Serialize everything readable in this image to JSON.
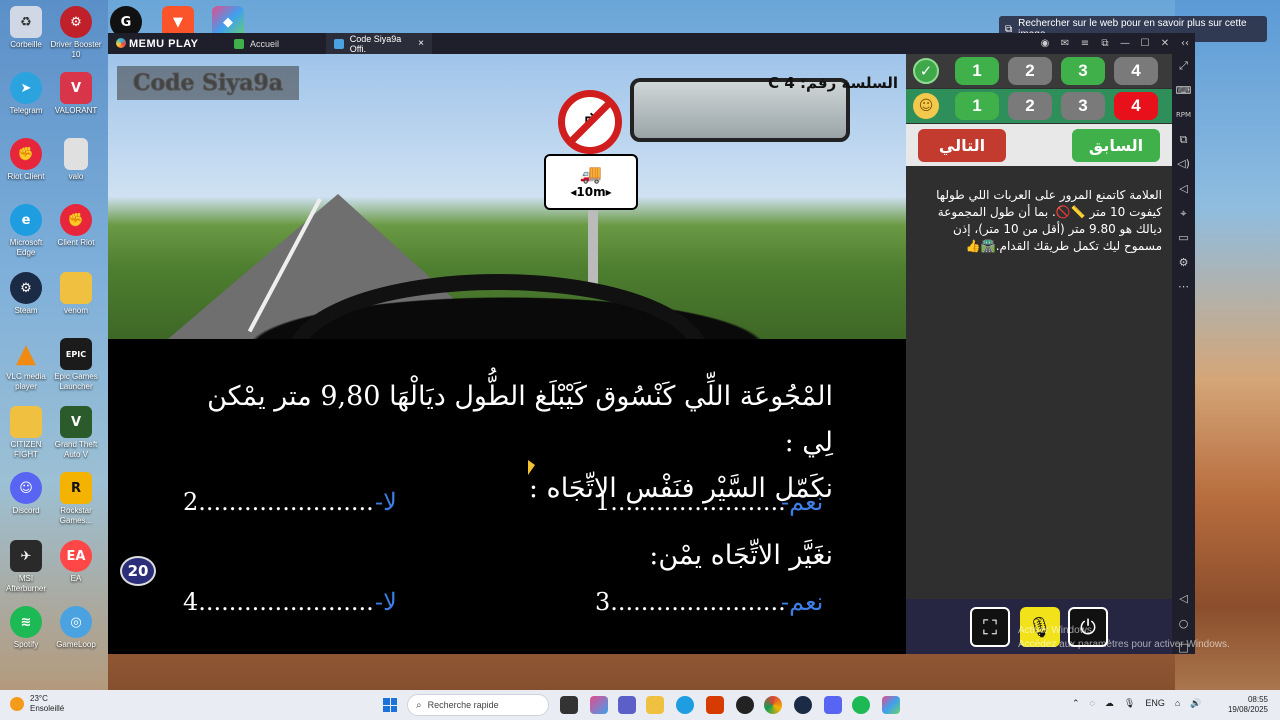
{
  "desktop": {
    "icons": [
      {
        "label": "Corbeille",
        "icon": "recycle-bin-icon",
        "color": "#cfd8e4"
      },
      {
        "label": "Telegram",
        "icon": "telegram-icon",
        "color": "#2aa3df"
      },
      {
        "label": "Riot Client",
        "icon": "riot-icon",
        "color": "#e8263b"
      },
      {
        "label": "Microsoft Edge",
        "icon": "edge-icon",
        "color": "#1f9de1"
      },
      {
        "label": "Steam",
        "icon": "steam-icon",
        "color": "#1b2a45"
      },
      {
        "label": "VLC media player",
        "icon": "vlc-icon",
        "color": "#f08a10"
      },
      {
        "label": "CITIZEN FIGHT",
        "icon": "folder-icon",
        "color": "#f0c040"
      },
      {
        "label": "Discord",
        "icon": "discord-icon",
        "color": "#5865f2"
      },
      {
        "label": "MSI Afterburner",
        "icon": "msi-icon",
        "color": "#2a2a2a"
      },
      {
        "label": "Spotify",
        "icon": "spotify-icon",
        "color": "#1db954"
      }
    ],
    "icons_col2": [
      {
        "label": "Driver Booster 10",
        "icon": "driver-booster-icon",
        "color": "#c0202a"
      },
      {
        "label": "VALORANT",
        "icon": "valorant-icon",
        "color": "#d8354a"
      },
      {
        "label": "valo",
        "icon": "file-icon",
        "color": "#e0e0e0"
      },
      {
        "label": "Client Riot",
        "icon": "riot-icon",
        "color": "#e8263b"
      },
      {
        "label": "venom",
        "icon": "folder-icon",
        "color": "#f0c040"
      },
      {
        "label": "Epic Games Launcher",
        "icon": "epic-icon",
        "color": "#1b1b1b"
      },
      {
        "label": "Grand Theft Auto V",
        "icon": "gta-icon",
        "color": "#2b5a2b"
      },
      {
        "label": "Rockstar Games...",
        "icon": "rockstar-icon",
        "color": "#f3b300"
      },
      {
        "label": "EA",
        "icon": "ea-icon",
        "color": "#ff4747"
      },
      {
        "label": "GameLoop",
        "icon": "gameloop-icon",
        "color": "#4aa3e0"
      }
    ]
  },
  "search_hint": "Rechercher sur le web pour en savoir plus sur cette image",
  "memu": {
    "logo": "MEMU PLAY",
    "tabs": [
      {
        "label": "Accueil",
        "color": "#3fb04a"
      },
      {
        "label": "Code Siya9a Offi.",
        "color": "#4aa3e0"
      }
    ],
    "close_tab": "×",
    "window_controls": [
      "◉",
      "✉",
      "≡",
      "⧉",
      "—",
      "☐",
      "✕",
      "‹‹"
    ]
  },
  "scene": {
    "brand": "Code Siya9a",
    "series": "السلسة رقم: 4 C",
    "panel_length": "◂10m▸",
    "truck": "🚚",
    "turn_arrow": "↱"
  },
  "question": {
    "line1": "المْجُوعَة اللِّي كَنْسُوق كَيْبْلَغ الطُّول ديَالْهَا 9,80 متر يمْكن لِي :",
    "line2": "نكَمّل السَّيْر فنَفْس الاتِّجَاه :",
    "opt1_label": "-نعم",
    "opt1_dots": "1.......................",
    "opt2_label": "-لا",
    "opt2_dots": "2.......................",
    "line3": "نغَيَّر الاتِّجَاه يمْن:",
    "opt3_label": "-نعم",
    "opt3_dots": "3.......................",
    "opt4_label": "-لا",
    "opt4_dots": "4.......................",
    "counter": "20"
  },
  "side": {
    "correct_row": [
      "1",
      "2",
      "3",
      "4"
    ],
    "user_row": [
      "1",
      "2",
      "3",
      "4"
    ],
    "prev_label": "السابق",
    "next_label": "التالي",
    "explanation": "العلامة كاتمنع المرور على العربات اللي طولها كيفوت 10 متر 📏🚫. بما أن طول المجموعة ديالك هو 9.80 متر (أقل من 10 متر)، إذن مسموح ليك تكمل طريقك القدام.🛣️👍"
  },
  "activate_text": "Activer Windows\nAccédez aux paramètres pour activer Windows.",
  "rail_icons": [
    "⤢",
    "⌨",
    "RPM",
    "⧉",
    "◁)",
    "◁",
    "⌖",
    "▭",
    "⚙",
    "⋯"
  ],
  "rail_bottom": [
    "◁",
    "○",
    "□"
  ],
  "taskbar": {
    "temp": "23°C",
    "weather": "Ensoleillé",
    "search": "Recherche rapide",
    "lang": "ENG",
    "time": "08:55",
    "date": "19/08/2025"
  }
}
